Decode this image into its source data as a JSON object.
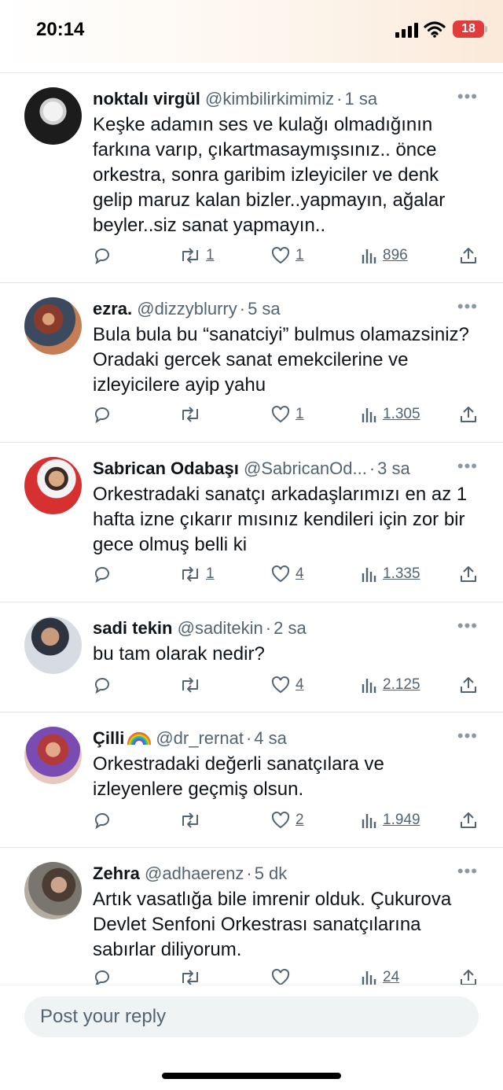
{
  "status": {
    "time": "20:14",
    "battery": "18"
  },
  "colors": {
    "text": "#0f1419",
    "muted": "#536471",
    "divider": "#e2e4e6",
    "input_bg": "#eff3f4",
    "battery": "#e23b3b"
  },
  "replies": [
    {
      "name": "noktalı virgül",
      "handle": "@kimbilirkimimiz",
      "time": "1 sa",
      "text": "Keşke adamın ses ve kulağı olmadığının farkına varıp, çıkartmasaymışsınız.. önce orkestra, sonra garibim izleyiciler ve denk gelip maruz kalan bizler..yapmayın, ağalar beyler..siz sanat yapmayın..",
      "retweets": "1",
      "likes": "1",
      "views": "896"
    },
    {
      "name": "ezra.",
      "handle": "@dizzyblurry",
      "time": "5 sa",
      "text": "Bula bula bu “sanatciyi” bulmus olamazsiniz? Oradaki gercek sanat emekcilerine ve izleyicilere ayip yahu",
      "retweets": "",
      "likes": "1",
      "views": "1.305"
    },
    {
      "name": "Sabrican Odabaşı",
      "handle": "@SabricanOd...",
      "time": "3 sa",
      "text": "Orkestradaki sanatçı arkadaşlarımızı en az 1 hafta izne çıkarır mısınız kendileri için zor bir gece olmuş belli ki",
      "retweets": "1",
      "likes": "4",
      "views": "1.335"
    },
    {
      "name": "sadi tekin",
      "handle": "@saditekin",
      "time": "2 sa",
      "text": "bu tam olarak nedir?",
      "retweets": "",
      "likes": "4",
      "views": "2.125"
    },
    {
      "name": "Çilli",
      "handle": "@dr_rernat",
      "time": "4 sa",
      "text": "Orkestradaki değerli sanatçılara ve izleyenlere geçmiş olsun.",
      "retweets": "",
      "likes": "2",
      "views": "1.949"
    },
    {
      "name": "Zehra",
      "handle": "@adhaerenz",
      "time": "5 dk",
      "text": "Artık vasatlığa bile imrenir olduk. Çukurova Devlet Senfoni Orkestrası sanatçılarına sabırlar diliyorum.",
      "retweets": "",
      "likes": "",
      "views": "24"
    }
  ],
  "compose": {
    "placeholder": "Post your reply"
  },
  "icons": {
    "reply": "reply-icon",
    "retweet": "retweet-icon",
    "like": "heart-icon",
    "views": "views-icon",
    "share": "share-icon",
    "more": "more-icon",
    "signal": "signal-icon",
    "wifi": "wifi-icon",
    "battery": "battery-icon",
    "emoji": "rainbow-icon"
  }
}
